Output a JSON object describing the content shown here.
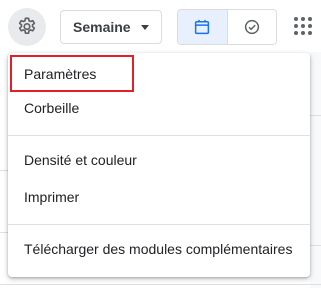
{
  "toolbar": {
    "view_selector": {
      "selected": "Semaine"
    },
    "icons": [
      "settings-gear-icon",
      "calendar-icon",
      "tasks-check-icon",
      "apps-grid-icon"
    ],
    "accent_color": "#1a73e8"
  },
  "settings_menu": {
    "items": [
      {
        "label": "Paramètres",
        "highlighted": true
      },
      {
        "label": "Corbeille"
      },
      {
        "label": "Densité et couleur"
      },
      {
        "label": "Imprimer"
      },
      {
        "label": "Télécharger des modules complémentaires"
      }
    ],
    "highlight_color": "#e2202a"
  }
}
